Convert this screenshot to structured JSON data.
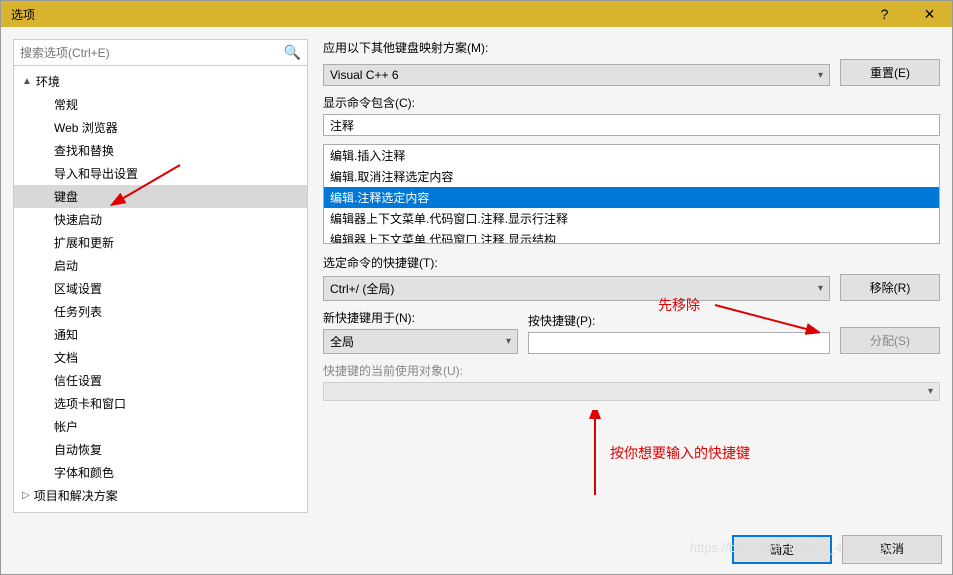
{
  "titlebar": {
    "title": "选项",
    "help": "?",
    "close": "×"
  },
  "search": {
    "placeholder": "搜索选项(Ctrl+E)"
  },
  "tree": {
    "parent1": "环境",
    "items": [
      "常规",
      "Web 浏览器",
      "查找和替换",
      "导入和导出设置",
      "键盘",
      "快速启动",
      "扩展和更新",
      "启动",
      "区域设置",
      "任务列表",
      "通知",
      "文档",
      "信任设置",
      "选项卡和窗口",
      "帐户",
      "自动恢复",
      "字体和颜色"
    ],
    "parent2": "项目和解决方案"
  },
  "right": {
    "scheme_label": "应用以下其他键盘映射方案(M):",
    "scheme_value": "Visual C++ 6",
    "reset_btn": "重置(E)",
    "filter_label": "显示命令包含(C):",
    "filter_value": "注释",
    "commands": [
      "编辑.插入注释",
      "编辑.取消注释选定内容",
      "编辑.注释选定内容",
      "编辑器上下文菜单.代码窗口.注释.显示行注释",
      "编辑器上下文菜单.代码窗口.注释.显示结构"
    ],
    "shortcut_label": "选定命令的快捷键(T):",
    "shortcut_value": "Ctrl+/ (全局)",
    "remove_btn": "移除(R)",
    "scope_label": "新快捷键用于(N):",
    "scope_value": "全局",
    "press_label": "按快捷键(P):",
    "assign_btn": "分配(S)",
    "used_label": "快捷键的当前使用对象(U):"
  },
  "footer": {
    "ok": "确定",
    "cancel": "取消"
  },
  "annotations": {
    "remove_first": "先移除",
    "press_hint": "按你想要输入的快捷键"
  },
  "watermark": "https://blog.csdn.net/m0_43456997"
}
